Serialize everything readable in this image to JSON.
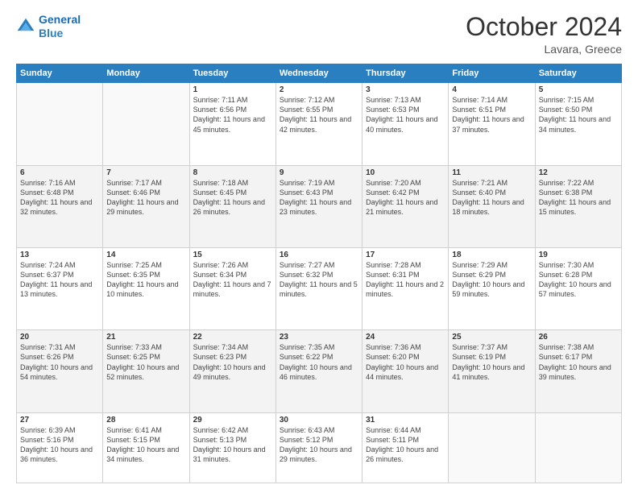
{
  "logo": {
    "line1": "General",
    "line2": "Blue"
  },
  "title": "October 2024",
  "subtitle": "Lavara, Greece",
  "weekdays": [
    "Sunday",
    "Monday",
    "Tuesday",
    "Wednesday",
    "Thursday",
    "Friday",
    "Saturday"
  ],
  "weeks": [
    [
      {
        "day": "",
        "sunrise": "",
        "sunset": "",
        "daylight": ""
      },
      {
        "day": "",
        "sunrise": "",
        "sunset": "",
        "daylight": ""
      },
      {
        "day": "1",
        "sunrise": "Sunrise: 7:11 AM",
        "sunset": "Sunset: 6:56 PM",
        "daylight": "Daylight: 11 hours and 45 minutes."
      },
      {
        "day": "2",
        "sunrise": "Sunrise: 7:12 AM",
        "sunset": "Sunset: 6:55 PM",
        "daylight": "Daylight: 11 hours and 42 minutes."
      },
      {
        "day": "3",
        "sunrise": "Sunrise: 7:13 AM",
        "sunset": "Sunset: 6:53 PM",
        "daylight": "Daylight: 11 hours and 40 minutes."
      },
      {
        "day": "4",
        "sunrise": "Sunrise: 7:14 AM",
        "sunset": "Sunset: 6:51 PM",
        "daylight": "Daylight: 11 hours and 37 minutes."
      },
      {
        "day": "5",
        "sunrise": "Sunrise: 7:15 AM",
        "sunset": "Sunset: 6:50 PM",
        "daylight": "Daylight: 11 hours and 34 minutes."
      }
    ],
    [
      {
        "day": "6",
        "sunrise": "Sunrise: 7:16 AM",
        "sunset": "Sunset: 6:48 PM",
        "daylight": "Daylight: 11 hours and 32 minutes."
      },
      {
        "day": "7",
        "sunrise": "Sunrise: 7:17 AM",
        "sunset": "Sunset: 6:46 PM",
        "daylight": "Daylight: 11 hours and 29 minutes."
      },
      {
        "day": "8",
        "sunrise": "Sunrise: 7:18 AM",
        "sunset": "Sunset: 6:45 PM",
        "daylight": "Daylight: 11 hours and 26 minutes."
      },
      {
        "day": "9",
        "sunrise": "Sunrise: 7:19 AM",
        "sunset": "Sunset: 6:43 PM",
        "daylight": "Daylight: 11 hours and 23 minutes."
      },
      {
        "day": "10",
        "sunrise": "Sunrise: 7:20 AM",
        "sunset": "Sunset: 6:42 PM",
        "daylight": "Daylight: 11 hours and 21 minutes."
      },
      {
        "day": "11",
        "sunrise": "Sunrise: 7:21 AM",
        "sunset": "Sunset: 6:40 PM",
        "daylight": "Daylight: 11 hours and 18 minutes."
      },
      {
        "day": "12",
        "sunrise": "Sunrise: 7:22 AM",
        "sunset": "Sunset: 6:38 PM",
        "daylight": "Daylight: 11 hours and 15 minutes."
      }
    ],
    [
      {
        "day": "13",
        "sunrise": "Sunrise: 7:24 AM",
        "sunset": "Sunset: 6:37 PM",
        "daylight": "Daylight: 11 hours and 13 minutes."
      },
      {
        "day": "14",
        "sunrise": "Sunrise: 7:25 AM",
        "sunset": "Sunset: 6:35 PM",
        "daylight": "Daylight: 11 hours and 10 minutes."
      },
      {
        "day": "15",
        "sunrise": "Sunrise: 7:26 AM",
        "sunset": "Sunset: 6:34 PM",
        "daylight": "Daylight: 11 hours and 7 minutes."
      },
      {
        "day": "16",
        "sunrise": "Sunrise: 7:27 AM",
        "sunset": "Sunset: 6:32 PM",
        "daylight": "Daylight: 11 hours and 5 minutes."
      },
      {
        "day": "17",
        "sunrise": "Sunrise: 7:28 AM",
        "sunset": "Sunset: 6:31 PM",
        "daylight": "Daylight: 11 hours and 2 minutes."
      },
      {
        "day": "18",
        "sunrise": "Sunrise: 7:29 AM",
        "sunset": "Sunset: 6:29 PM",
        "daylight": "Daylight: 10 hours and 59 minutes."
      },
      {
        "day": "19",
        "sunrise": "Sunrise: 7:30 AM",
        "sunset": "Sunset: 6:28 PM",
        "daylight": "Daylight: 10 hours and 57 minutes."
      }
    ],
    [
      {
        "day": "20",
        "sunrise": "Sunrise: 7:31 AM",
        "sunset": "Sunset: 6:26 PM",
        "daylight": "Daylight: 10 hours and 54 minutes."
      },
      {
        "day": "21",
        "sunrise": "Sunrise: 7:33 AM",
        "sunset": "Sunset: 6:25 PM",
        "daylight": "Daylight: 10 hours and 52 minutes."
      },
      {
        "day": "22",
        "sunrise": "Sunrise: 7:34 AM",
        "sunset": "Sunset: 6:23 PM",
        "daylight": "Daylight: 10 hours and 49 minutes."
      },
      {
        "day": "23",
        "sunrise": "Sunrise: 7:35 AM",
        "sunset": "Sunset: 6:22 PM",
        "daylight": "Daylight: 10 hours and 46 minutes."
      },
      {
        "day": "24",
        "sunrise": "Sunrise: 7:36 AM",
        "sunset": "Sunset: 6:20 PM",
        "daylight": "Daylight: 10 hours and 44 minutes."
      },
      {
        "day": "25",
        "sunrise": "Sunrise: 7:37 AM",
        "sunset": "Sunset: 6:19 PM",
        "daylight": "Daylight: 10 hours and 41 minutes."
      },
      {
        "day": "26",
        "sunrise": "Sunrise: 7:38 AM",
        "sunset": "Sunset: 6:17 PM",
        "daylight": "Daylight: 10 hours and 39 minutes."
      }
    ],
    [
      {
        "day": "27",
        "sunrise": "Sunrise: 6:39 AM",
        "sunset": "Sunset: 5:16 PM",
        "daylight": "Daylight: 10 hours and 36 minutes."
      },
      {
        "day": "28",
        "sunrise": "Sunrise: 6:41 AM",
        "sunset": "Sunset: 5:15 PM",
        "daylight": "Daylight: 10 hours and 34 minutes."
      },
      {
        "day": "29",
        "sunrise": "Sunrise: 6:42 AM",
        "sunset": "Sunset: 5:13 PM",
        "daylight": "Daylight: 10 hours and 31 minutes."
      },
      {
        "day": "30",
        "sunrise": "Sunrise: 6:43 AM",
        "sunset": "Sunset: 5:12 PM",
        "daylight": "Daylight: 10 hours and 29 minutes."
      },
      {
        "day": "31",
        "sunrise": "Sunrise: 6:44 AM",
        "sunset": "Sunset: 5:11 PM",
        "daylight": "Daylight: 10 hours and 26 minutes."
      },
      {
        "day": "",
        "sunrise": "",
        "sunset": "",
        "daylight": ""
      },
      {
        "day": "",
        "sunrise": "",
        "sunset": "",
        "daylight": ""
      }
    ]
  ]
}
